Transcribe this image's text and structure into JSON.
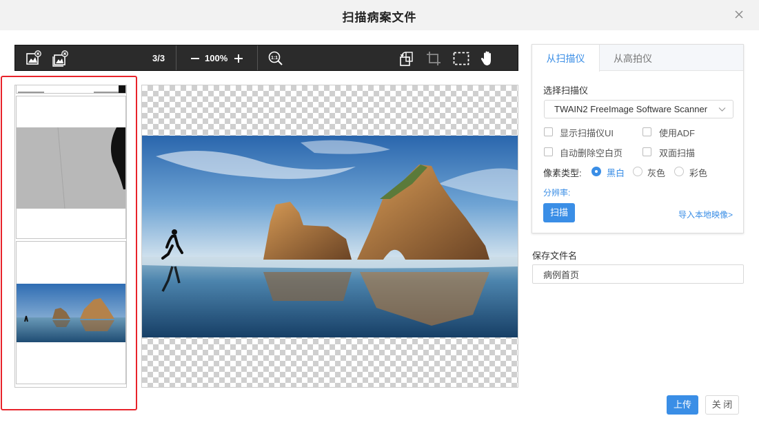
{
  "dialog": {
    "title": "扫描病案文件"
  },
  "toolbar": {
    "page_indicator": "3/3",
    "zoom": "100%"
  },
  "thumbnails": [
    {
      "name": "page-1",
      "content": "document-strip"
    },
    {
      "name": "page-2",
      "content": "gray-scan"
    },
    {
      "name": "page-3",
      "content": "landscape-photo"
    }
  ],
  "scanner": {
    "tabs": [
      "从扫描仪",
      "从高拍仪"
    ],
    "select_label": "选择扫描仪",
    "selected_scanner": "TWAIN2 FreeImage Software Scanner",
    "options": {
      "show_ui": "显示扫描仪UI",
      "use_adf": "使用ADF",
      "auto_delete_blank": "自动删除空白页",
      "duplex": "双面扫描"
    },
    "pixel_type_label": "像素类型:",
    "pixel_types": [
      "黑白",
      "灰色",
      "彩色"
    ],
    "selected_pixel_type": "黑白",
    "resolution_label": "分辨率:",
    "scan_button": "扫描",
    "import_link": "导入本地映像>"
  },
  "save": {
    "label": "保存文件名",
    "value": "病例首页"
  },
  "footer": {
    "upload_button": "上传",
    "close_button": "关 闭"
  },
  "colors": {
    "accent": "#3a8ee6",
    "toolbar_bg": "#2b2b2b",
    "highlight_border": "#e8222a"
  }
}
